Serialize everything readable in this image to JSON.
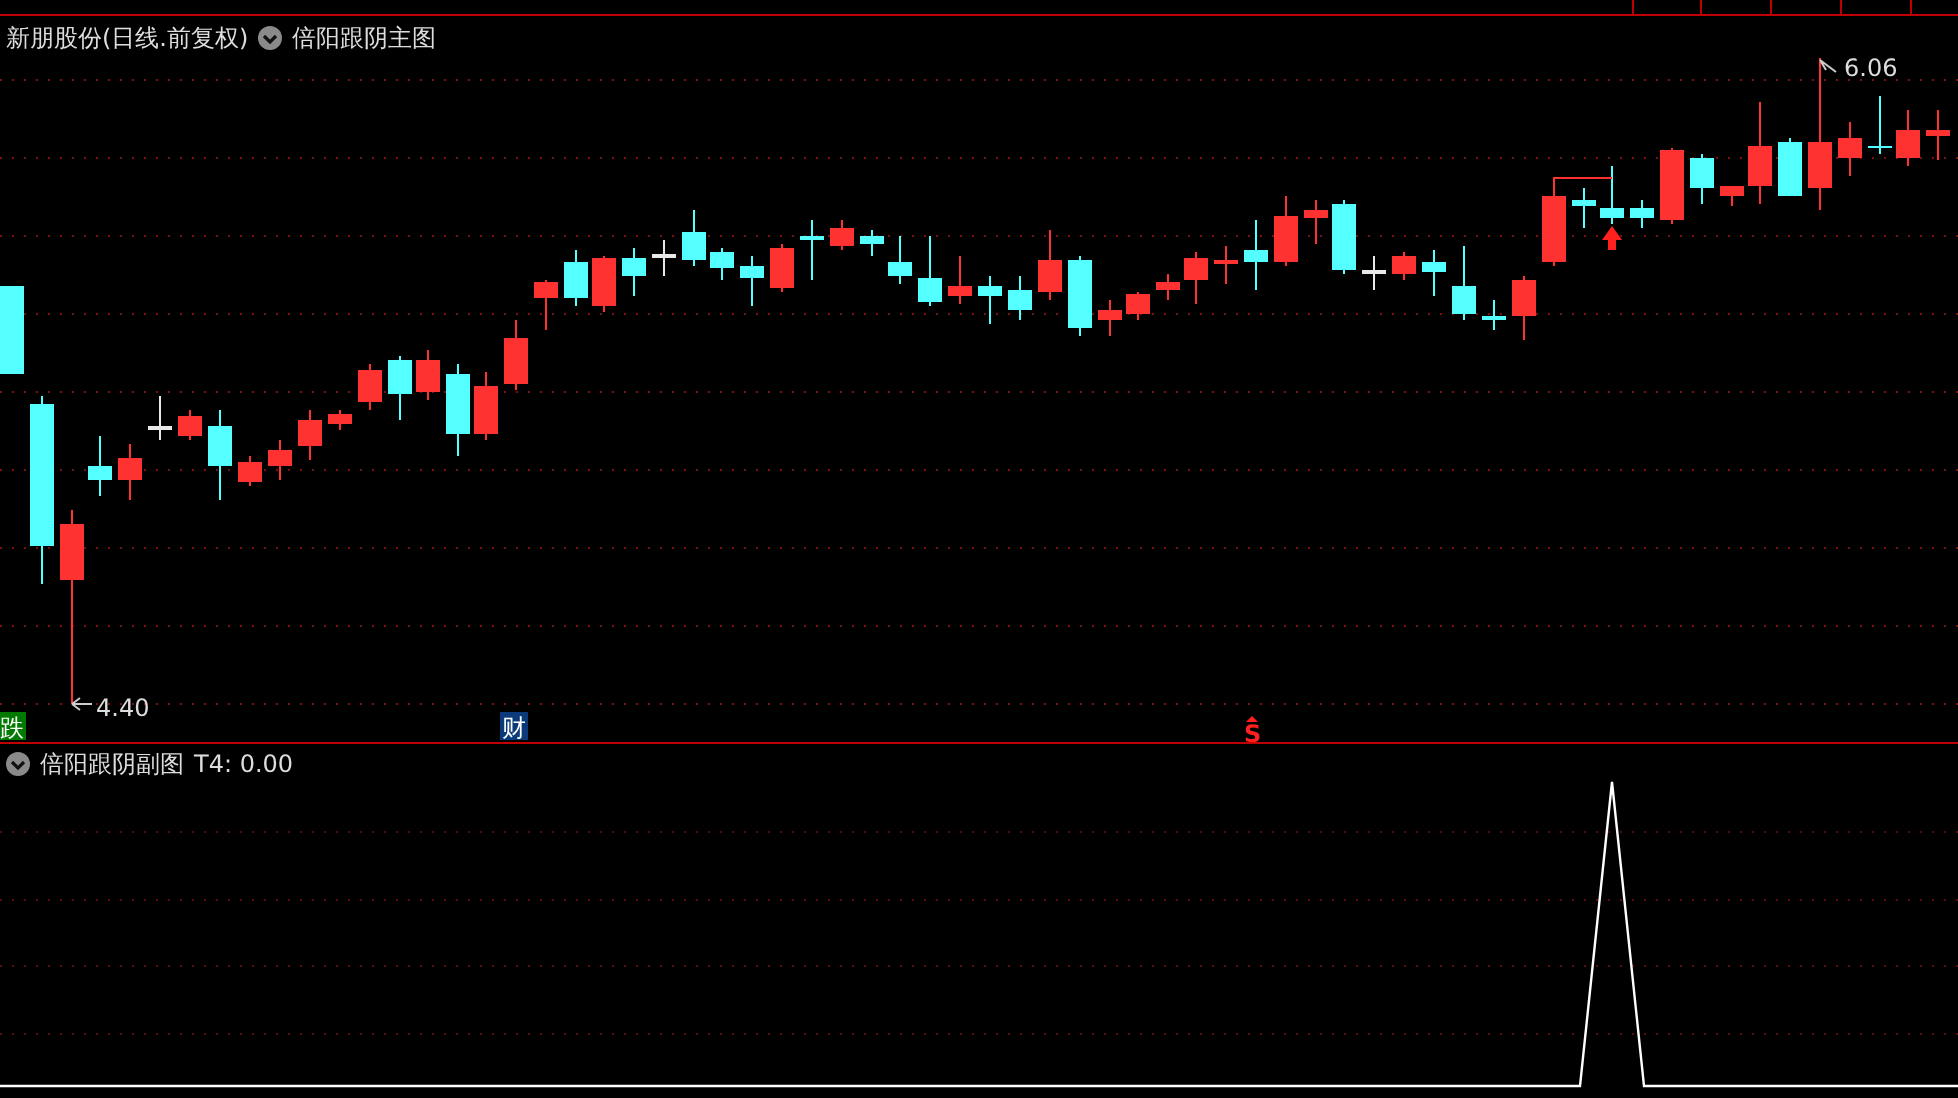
{
  "main_chart": {
    "stock_title": "新朋股份(日线.前复权)",
    "indicator_name": "倍阳跟阴主图",
    "high_label": "6.06",
    "low_label": "4.40",
    "markers": [
      {
        "text": "跌",
        "kind": "fall"
      },
      {
        "text": "财",
        "kind": "finance"
      },
      {
        "text": "S",
        "kind": "sell"
      }
    ]
  },
  "sub_chart": {
    "indicator_name": "倍阳跟阴副图",
    "reading": "T4: 0.00"
  }
}
